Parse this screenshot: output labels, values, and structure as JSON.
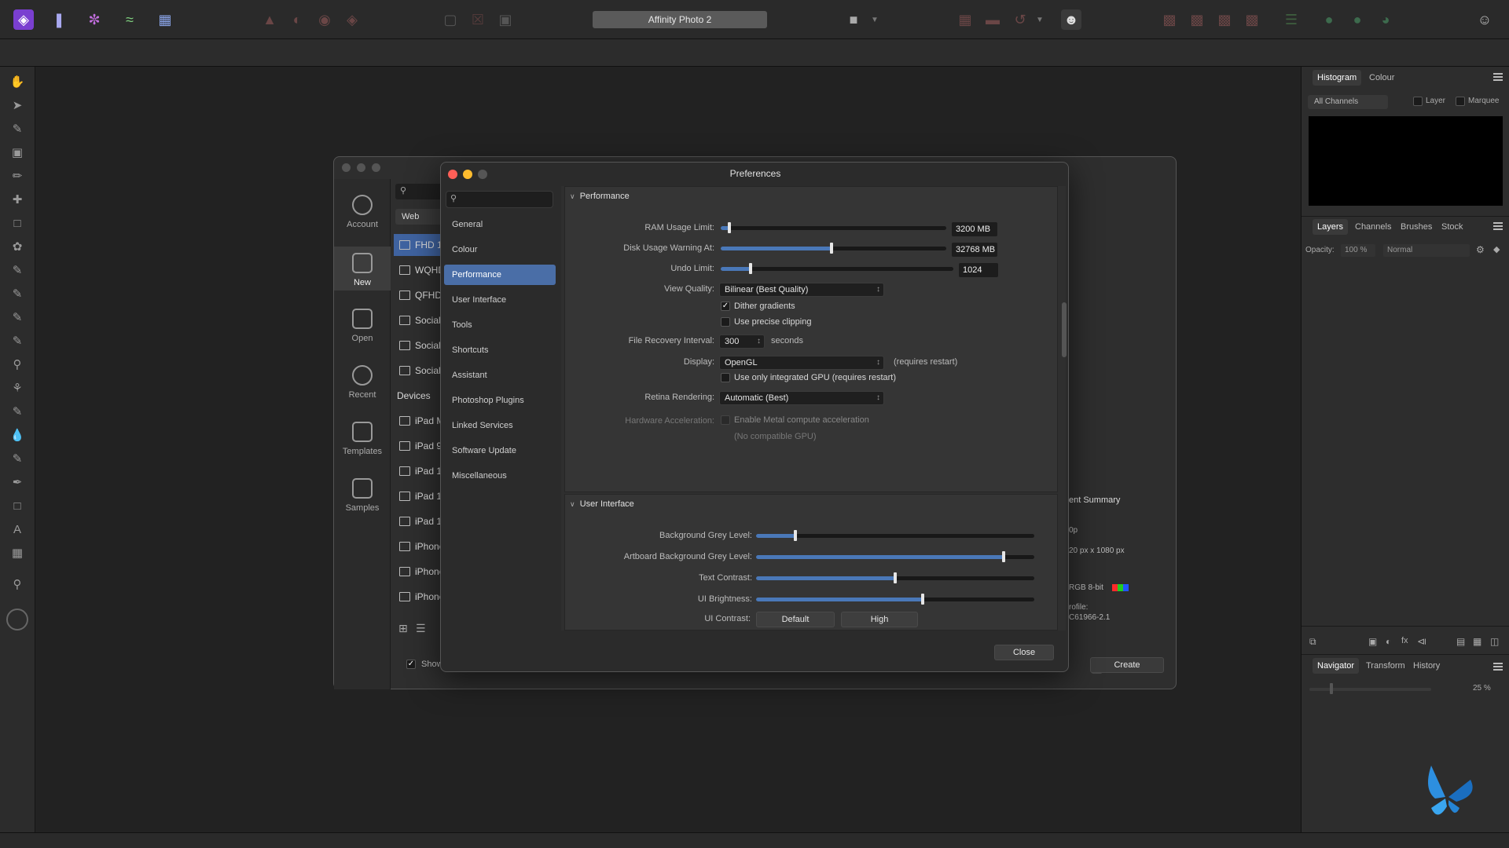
{
  "app": {
    "title": "Affinity Photo 2"
  },
  "new_document": {
    "sidebar": [
      {
        "label": "Account",
        "icon": "account-icon"
      },
      {
        "label": "New",
        "icon": "new-document-icon"
      },
      {
        "label": "Open",
        "icon": "folder-icon"
      },
      {
        "label": "Recent",
        "icon": "clock-icon"
      },
      {
        "label": "Templates",
        "icon": "templates-icon"
      },
      {
        "label": "Samples",
        "icon": "image-icon"
      }
    ],
    "category": "Web",
    "presets": [
      "FHD 10",
      "WQHD",
      "QFHD",
      "Social",
      "Social",
      "Social"
    ],
    "devices_header": "Devices",
    "devices": [
      "iPad M",
      "iPad 9.",
      "iPad 10",
      "iPad 11",
      "iPad 12",
      "iPhone",
      "iPhone",
      "iPhone"
    ],
    "summary_title": "ent Summary",
    "summary_lines": [
      "0p",
      "20 px x 1080 px",
      "RGB 8-bit",
      "rofile:",
      "C61966-2.1"
    ],
    "show_label": "Show",
    "create_button": "Create",
    "color_swatches": [
      "#ff2a2a",
      "#22cc22",
      "#2255ff"
    ]
  },
  "preferences": {
    "title": "Preferences",
    "nav": [
      "General",
      "Colour",
      "Performance",
      "User Interface",
      "Tools",
      "Shortcuts",
      "Assistant",
      "Photoshop Plugins",
      "Linked Services",
      "Software Update",
      "Miscellaneous"
    ],
    "selected_nav": "Performance",
    "performance": {
      "header": "Performance",
      "ram_label": "RAM Usage Limit:",
      "ram_value": "3200 MB",
      "ram_fraction": 0.04,
      "disk_label": "Disk Usage Warning At:",
      "disk_value": "32768 MB",
      "disk_fraction": 0.49,
      "undo_label": "Undo Limit:",
      "undo_value": "1024",
      "undo_fraction": 0.13,
      "view_quality_label": "View Quality:",
      "view_quality_value": "Bilinear (Best Quality)",
      "dither_label": "Dither gradients",
      "dither_checked": true,
      "precise_label": "Use precise clipping",
      "precise_checked": false,
      "recovery_label": "File Recovery Interval:",
      "recovery_value": "300",
      "recovery_unit": "seconds",
      "display_label": "Display:",
      "display_value": "OpenGL",
      "display_note": "(requires restart)",
      "gpu_label": "Use only integrated GPU (requires restart)",
      "retina_label": "Retina Rendering:",
      "retina_value": "Automatic (Best)",
      "hwaccel_label": "Hardware Acceleration:",
      "metal_label": "Enable Metal compute acceleration",
      "no_gpu_note": "(No compatible GPU)"
    },
    "user_interface": {
      "header": "User Interface",
      "bg_grey_label": "Background Grey Level:",
      "bg_grey_fraction": 0.14,
      "artboard_label": "Artboard Background Grey Level:",
      "artboard_fraction": 0.89,
      "text_contrast_label": "Text Contrast:",
      "text_contrast_fraction": 0.5,
      "brightness_label": "UI Brightness:",
      "brightness_fraction": 0.6,
      "ui_contrast_label": "UI Contrast:",
      "contrast_default": "Default",
      "contrast_high": "High"
    },
    "close_button": "Close"
  },
  "right_panel": {
    "top_tabs": [
      "Histogram",
      "Colour"
    ],
    "channels": "All Channels",
    "layer_label": "Layer",
    "marquee_label": "Marquee",
    "mid_tabs": [
      "Layers",
      "Channels",
      "Brushes",
      "Stock"
    ],
    "opacity_label": "Opacity:",
    "opacity_value": "100 %",
    "blend_mode": "Normal",
    "bottom_tabs": [
      "Navigator",
      "Transform",
      "History"
    ],
    "zoom_value": "25 %"
  }
}
